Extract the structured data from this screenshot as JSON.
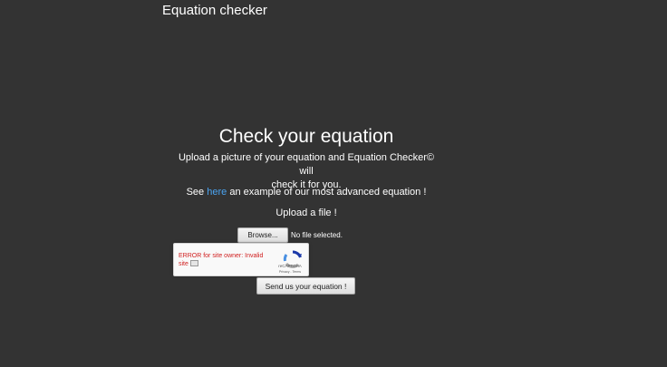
{
  "navbar": {
    "brand": "Equation checker"
  },
  "main": {
    "heading": "Check your equation",
    "lead_line1": "Upload a picture of your equation and Equation Checker© will",
    "lead_line2": "check it for you.",
    "see_prefix": "See ",
    "see_link": "here",
    "see_suffix": " an example of our most advanced equation !",
    "upload_label": "Upload a file !",
    "browse_label": "Browse...",
    "no_file_text": "No file selected.",
    "send_label": "Send us your equation !"
  },
  "recaptcha": {
    "error_line1": "ERROR for site owner: Invalid",
    "error_line2": "site",
    "brand": "reCAPTCHA",
    "links": "Privacy - Terms"
  },
  "colors": {
    "background": "#333333",
    "link": "#4aa3f0",
    "error": "#d01f1f"
  }
}
